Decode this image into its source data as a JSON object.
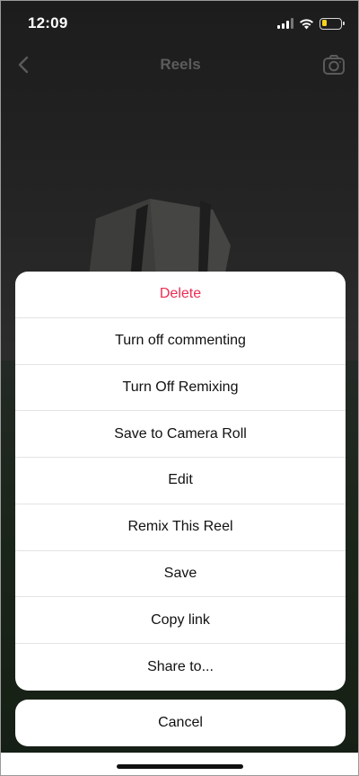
{
  "status_bar": {
    "time": "12:09",
    "battery_level": 0.3,
    "battery_color": "#f7d21a"
  },
  "header": {
    "title": "Reels",
    "back_icon": "chevron-left-icon",
    "camera_icon": "camera-icon"
  },
  "action_sheet": {
    "items": [
      {
        "label": "Delete",
        "style": "destructive",
        "color": "#ee2c52"
      },
      {
        "label": "Turn off commenting"
      },
      {
        "label": "Turn Off Remixing"
      },
      {
        "label": "Save to Camera Roll"
      },
      {
        "label": "Edit"
      },
      {
        "label": "Remix This Reel"
      },
      {
        "label": "Save"
      },
      {
        "label": "Copy link"
      },
      {
        "label": "Share to..."
      }
    ],
    "cancel_label": "Cancel"
  }
}
